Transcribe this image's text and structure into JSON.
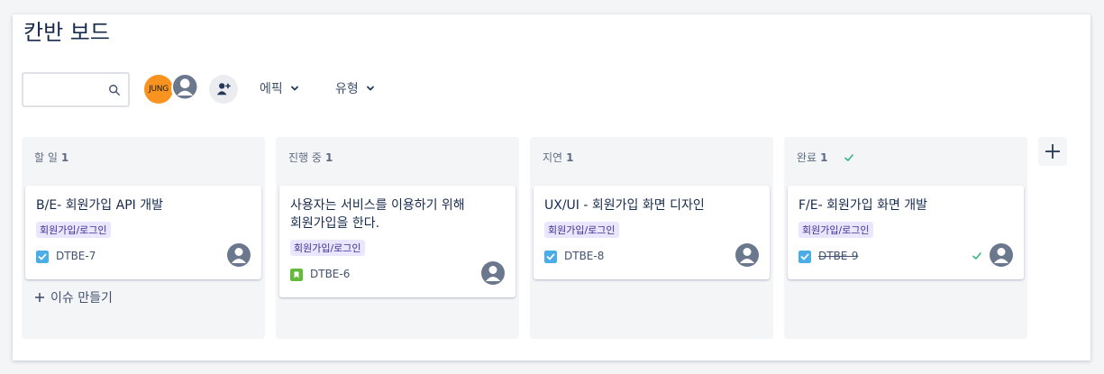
{
  "board": {
    "title": "칸반 보드"
  },
  "toolbar": {
    "search": {
      "value": "",
      "placeholder": ""
    },
    "avatar_initials": "JUNG",
    "filters": {
      "epic": "에픽",
      "type": "유형"
    }
  },
  "columns": [
    {
      "name": "할 일",
      "count": "1",
      "done_mark": false,
      "card": {
        "title": "B/E- 회원가입 API 개발",
        "label": "회원가입/로그인",
        "key": "DTBE-7",
        "type": "task",
        "done": false
      },
      "create_label": "이슈 만들기"
    },
    {
      "name": "진행 중",
      "count": "1",
      "done_mark": false,
      "card": {
        "title": "사용자는 서비스를 이용하기 위해 회원가입을 한다.",
        "label": "회원가입/로그인",
        "key": "DTBE-6",
        "type": "story",
        "done": false
      }
    },
    {
      "name": "지연",
      "count": "1",
      "done_mark": false,
      "card": {
        "title": "UX/UI - 회원가입 화면 디자인",
        "label": "회원가입/로그인",
        "key": "DTBE-8",
        "type": "task",
        "done": false
      }
    },
    {
      "name": "완료",
      "count": "1",
      "done_mark": true,
      "card": {
        "title": "F/E- 회원가입 화면 개발",
        "label": "회원가입/로그인",
        "key": "DTBE-9",
        "type": "task",
        "done": true
      }
    }
  ],
  "colors": {
    "task": "#4bade8",
    "story": "#63ba3c",
    "label_bg": "#eae6ff",
    "label_text": "#403294",
    "avatar_orange": "#f7931e",
    "done_green": "#36b37e"
  },
  "icons": {
    "search": "search-icon",
    "add_person": "add-person-icon",
    "chevron": "chevron-down-icon",
    "plus": "plus-icon",
    "check": "check-icon",
    "user": "user-avatar-icon"
  }
}
